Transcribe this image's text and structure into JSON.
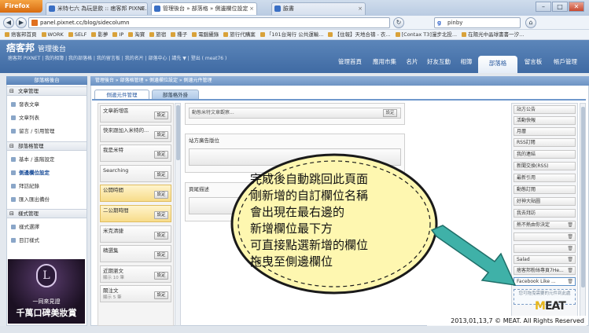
{
  "browser": {
    "app_button": "Firefox",
    "tabs": [
      {
        "label": "米特七六 為玩是飲 :: 痞客邦 PIXNE..."
      },
      {
        "label": "管理後台 » 部落格 » 側邊欄位設定"
      },
      {
        "label": "臉書"
      }
    ],
    "url": "panel.pixnet.cc/blog/sidecolumn",
    "search": "pinby",
    "bookmarks": [
      "痞客邦首頁",
      "WORK",
      "SELF",
      "影夢",
      "IP",
      "淘寶",
      "旅宿",
      "種子",
      "電腦攝錄",
      "旅行代購案",
      "「101台灣行 公共運輸...",
      "【住報】天地合禱 - 衣...",
      "[Contax T3]漫步北投...",
      "在陽光中晶球書書一汐..."
    ]
  },
  "site": {
    "logo": "痞客邦",
    "logo_sub": "管理後台",
    "user_links": "痞客邦 PIXNET | 我的相簿 | 我的部落格 | 我的留言板 | 我的名片 | 部落中心 | 請先 ▼ | 登出 ( meat76 )",
    "nav": [
      "管理首頁",
      "應用市集",
      "名片",
      "好友互動",
      "相簿",
      "部落格",
      "留言板",
      "帳戶管理"
    ],
    "active_nav": "部落格"
  },
  "sidebar": {
    "head": "部落格後台",
    "sections": [
      {
        "title": "文章管理",
        "items": [
          "發表文章",
          "文章列表",
          "留言 / 引用管理"
        ]
      },
      {
        "title": "部落格管理",
        "items": [
          "基本 / 進階設定",
          "側邊欄位設定",
          "拜訪紀錄",
          "匯入匯出備份"
        ]
      },
      {
        "title": "樣式管理",
        "items": [
          "樣式選擇",
          "目訂樣式"
        ]
      }
    ],
    "selected": "側邊欄位設定",
    "promo_line1": "一同來見證",
    "promo_line2": "千萬口碑美妝賞"
  },
  "content": {
    "breadcrumb": "管理後台 » 部落格管理 » 側邊欄位設定 » 側邊元件管理",
    "tabs": [
      "側邊元件管理",
      "部落格外掛"
    ],
    "elements": [
      {
        "label": "文章新增區",
        "btn": "設定"
      },
      {
        "label": "快來跟加入米特的...",
        "btn": "設定"
      },
      {
        "label": "我是米特",
        "btn": "設定"
      },
      {
        "label": "Searching",
        "btn": "設定"
      },
      {
        "label": "公開時間",
        "btn": "設定"
      },
      {
        "label": "二公期時間",
        "btn": "設定"
      },
      {
        "label": "米克清捷",
        "btn": "設定"
      },
      {
        "label": "精選集",
        "btn": "設定"
      },
      {
        "label": "近期瀏文",
        "sub": "顯示 10 筆",
        "btn": "設定"
      },
      {
        "label": "關注文",
        "sub": "顯示 5 筆",
        "btn": "設定"
      }
    ],
    "mid_boxes": [
      {
        "bar": "動態米特文章觀察...",
        "btn": "設定"
      },
      {
        "title": "站方廣告版位"
      },
      {
        "title": "頁尾描述"
      }
    ],
    "right_elements": [
      "站方公告",
      "活動快報",
      "月曆",
      "RSS訂閱",
      "我的連結",
      "新聞交換(RSS)",
      "最新引用",
      "動態訂閱",
      "好神大貼圖",
      "我去拜訪",
      "熱不熱由你決定",
      "",
      "",
      "Salad",
      "痞客邦粉絲專頁7He...",
      "Facebook Like ..."
    ],
    "drop_hint": "您可拖曳需要的元件到此處"
  },
  "annotation": {
    "lines": [
      "完成後自動跳回此頁面",
      "剛新增的自訂欄位名稱",
      "會出現在最右邊的",
      "新增欄位最下方",
      "可直接點選新增的欄位",
      "拖曳至側邊欄位"
    ]
  },
  "watermark": {
    "logo": "MEAT",
    "copyright": "2013,01,13,7 © MEAT. All Rights Reserved"
  }
}
